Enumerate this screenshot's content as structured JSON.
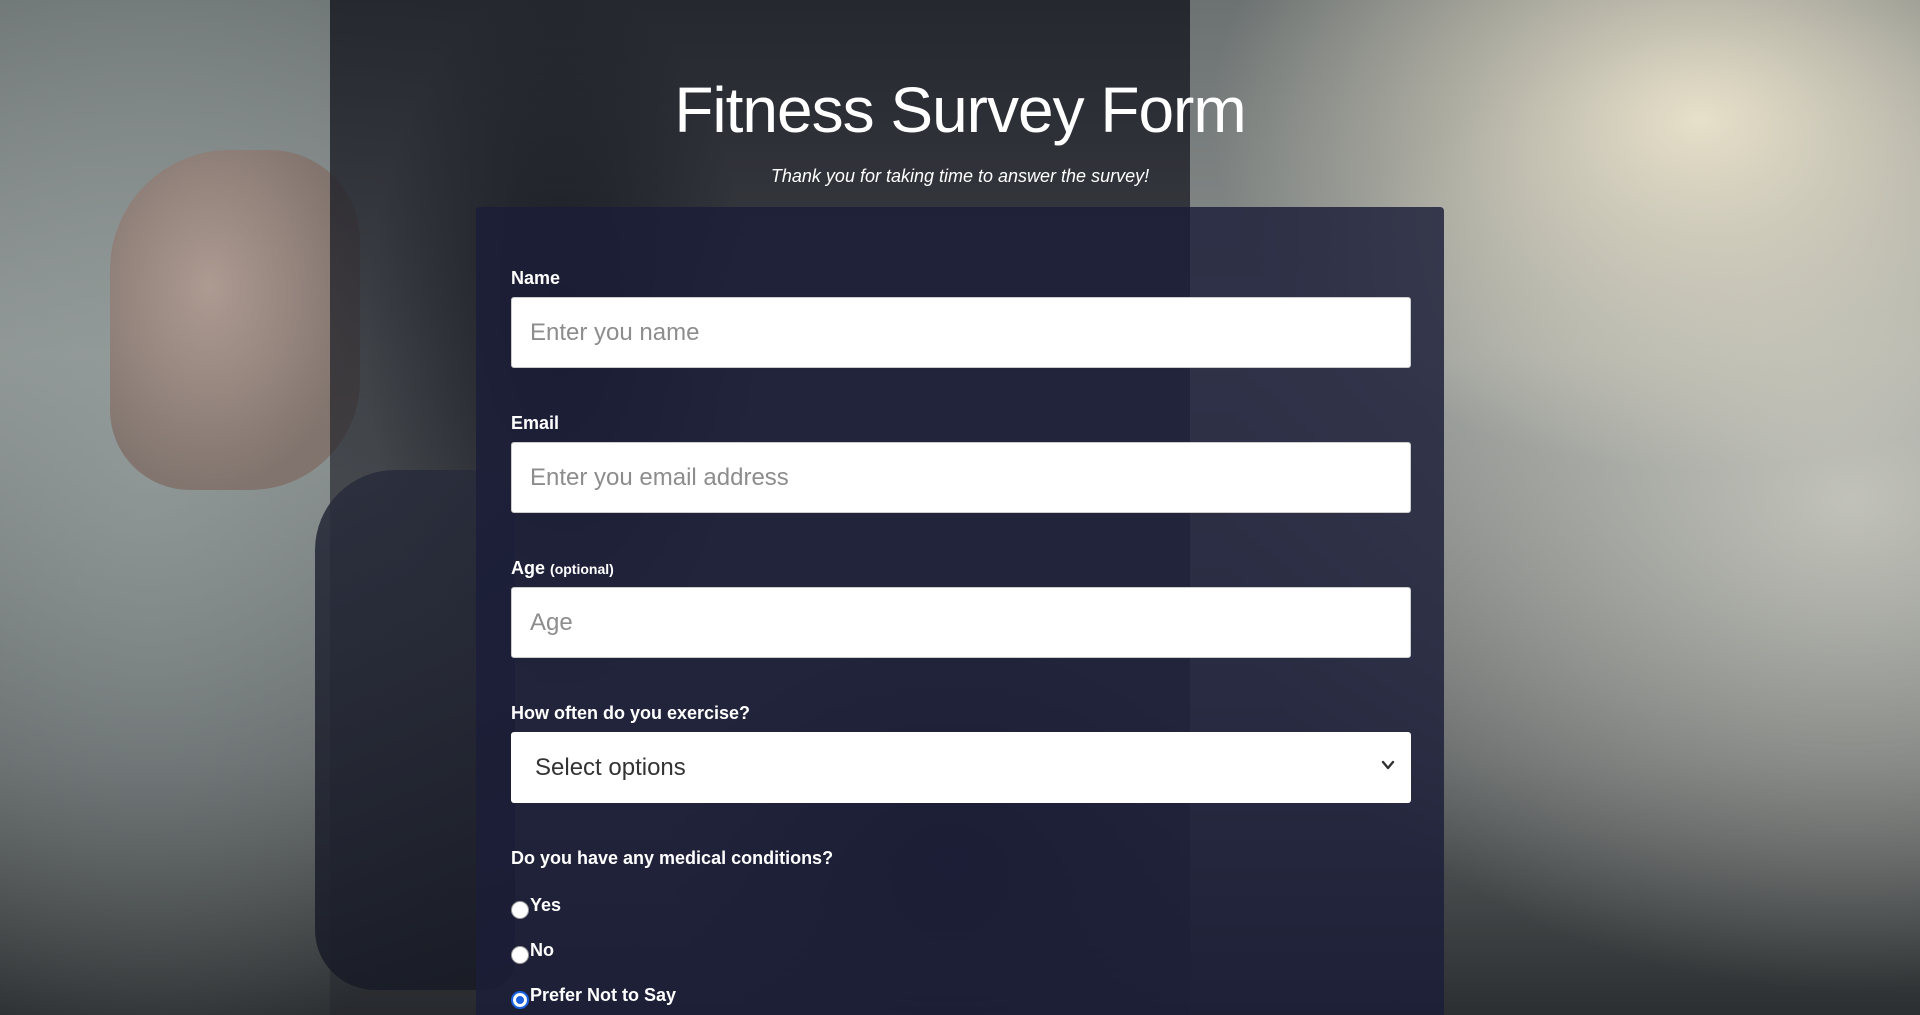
{
  "header": {
    "title": "Fitness Survey Form",
    "description": "Thank you for taking time to answer the survey!"
  },
  "form": {
    "name": {
      "label": "Name",
      "placeholder": "Enter you name"
    },
    "email": {
      "label": "Email",
      "placeholder": "Enter you email address"
    },
    "age": {
      "label": "Age",
      "label_note": "(optional)",
      "placeholder": "Age"
    },
    "exercise": {
      "label": "How often do you exercise?",
      "selected": "Select options"
    },
    "medical": {
      "question": "Do you have any medical conditions?",
      "options": [
        {
          "label": "Yes",
          "checked": false
        },
        {
          "label": "No",
          "checked": false
        },
        {
          "label": "Prefer Not to Say",
          "checked": true
        }
      ]
    }
  },
  "colors": {
    "form_background": "#1b1d38",
    "radio_accent": "#1a62e0"
  },
  "icons": {
    "select_arrow": "chevron-down-icon"
  }
}
